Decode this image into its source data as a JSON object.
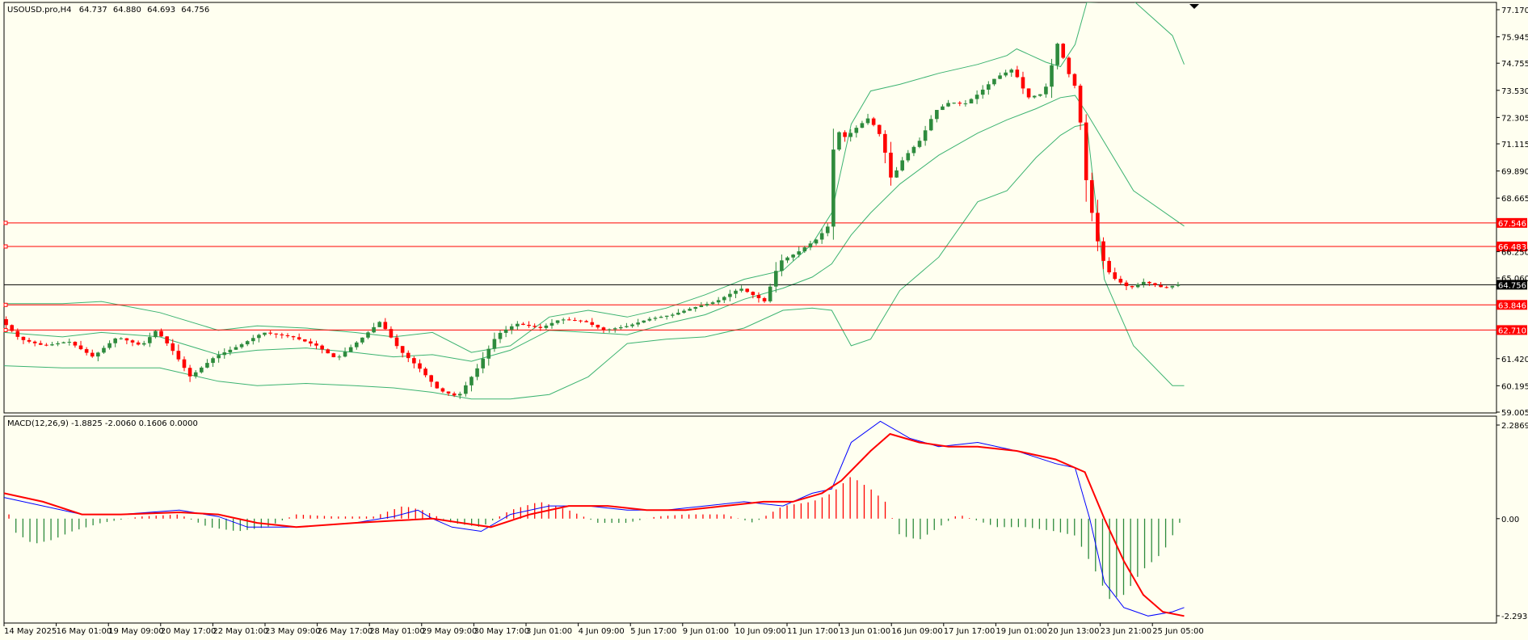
{
  "window_title": "USOUSD.pro,H4",
  "ohlc": {
    "open": "64.737",
    "high": "64.880",
    "low": "64.693",
    "close": "64.756"
  },
  "colors": {
    "background": "#fffff0",
    "bull": "#2e8b3d",
    "bear": "#ff0000",
    "bands": "#3cb371",
    "level_lines": "#ff0000",
    "price_line": "#000000",
    "macd_line": "#0000ff",
    "signal_line": "#ff0000",
    "hist_pos": "#ff0000",
    "hist_neg": "#2e8b3d"
  },
  "price_axis": {
    "ticks": [
      "77.170",
      "75.945",
      "74.755",
      "73.530",
      "72.305",
      "71.115",
      "69.890",
      "68.665",
      "66.250",
      "65.060",
      "61.420",
      "60.195",
      "59.005"
    ],
    "range": [
      59.005,
      77.17
    ]
  },
  "levels": [
    {
      "value": 67.546,
      "label": "67.546"
    },
    {
      "value": 66.483,
      "label": "66.483"
    },
    {
      "value": 63.846,
      "label": "63.846"
    },
    {
      "value": 62.71,
      "label": "62.710"
    }
  ],
  "current_price": {
    "value": 64.756,
    "label": "64.756"
  },
  "macd": {
    "title": "MACD(12,26,9) -1.8825 -2.0060 0.1606 0.0000",
    "axis_ticks": [
      "2.2869",
      "0.00",
      "-2.2938"
    ],
    "range": [
      -2.2938,
      2.2869
    ]
  },
  "time_axis": {
    "labels": [
      "14 May 2025",
      "16 May 01:00",
      "19 May 09:00",
      "20 May 17:00",
      "22 May 01:00",
      "23 May 09:00",
      "26 May 17:00",
      "28 May 01:00",
      "29 May 09:00",
      "30 May 17:00",
      "3 Jun 01:00",
      "4 Jun 09:00",
      "5 Jun 17:00",
      "9 Jun 01:00",
      "10 Jun 09:00",
      "11 Jun 17:00",
      "13 Jun 01:00",
      "16 Jun 09:00",
      "17 Jun 17:00",
      "19 Jun 01:00",
      "20 Jun 13:00",
      "23 Jun 21:00",
      "25 Jun 05:00"
    ]
  },
  "chart_data": {
    "type": "candlestick",
    "title": "USOUSD.pro,H4",
    "price_range": [
      59.005,
      77.17
    ],
    "segments": [
      [
        0,
        63.2
      ],
      [
        20,
        62.3
      ],
      [
        45,
        62.0
      ],
      [
        70,
        62.2
      ],
      [
        95,
        61.5
      ],
      [
        120,
        62.4
      ],
      [
        145,
        62.0
      ],
      [
        160,
        62.7
      ],
      [
        175,
        61.9
      ],
      [
        195,
        60.6
      ],
      [
        220,
        61.5
      ],
      [
        245,
        62.0
      ],
      [
        270,
        62.6
      ],
      [
        300,
        62.4
      ],
      [
        325,
        62.0
      ],
      [
        345,
        61.4
      ],
      [
        370,
        62.3
      ],
      [
        390,
        63.1
      ],
      [
        410,
        61.8
      ],
      [
        430,
        61.0
      ],
      [
        450,
        60.0
      ],
      [
        470,
        59.7
      ],
      [
        490,
        61.0
      ],
      [
        510,
        62.5
      ],
      [
        530,
        63.0
      ],
      [
        555,
        62.8
      ],
      [
        575,
        63.2
      ],
      [
        600,
        63.1
      ],
      [
        620,
        62.7
      ],
      [
        645,
        62.9
      ],
      [
        665,
        63.2
      ],
      [
        690,
        63.4
      ],
      [
        710,
        63.7
      ],
      [
        735,
        64.0
      ],
      [
        760,
        64.6
      ],
      [
        785,
        64.0
      ],
      [
        800,
        65.8
      ],
      [
        818,
        66.2
      ],
      [
        838,
        66.8
      ],
      [
        850,
        67.4
      ],
      [
        857,
        71.8
      ],
      [
        868,
        71.4
      ],
      [
        878,
        71.8
      ],
      [
        892,
        72.3
      ],
      [
        905,
        71.4
      ],
      [
        915,
        69.5
      ],
      [
        928,
        70.5
      ],
      [
        945,
        71.3
      ],
      [
        960,
        72.6
      ],
      [
        975,
        73.0
      ],
      [
        990,
        72.9
      ],
      [
        1005,
        73.4
      ],
      [
        1022,
        74.1
      ],
      [
        1040,
        74.5
      ],
      [
        1055,
        73.2
      ],
      [
        1072,
        73.4
      ],
      [
        1086,
        75.7
      ],
      [
        1097,
        74.3
      ],
      [
        1106,
        73.5
      ],
      [
        1115,
        69.5
      ],
      [
        1125,
        67.0
      ],
      [
        1135,
        65.5
      ],
      [
        1145,
        65.0
      ],
      [
        1160,
        64.6
      ],
      [
        1175,
        64.9
      ],
      [
        1195,
        64.6
      ],
      [
        1208,
        64.76
      ]
    ],
    "bollinger": {
      "upper": [
        [
          0,
          63.9
        ],
        [
          60,
          63.9
        ],
        [
          100,
          64.0
        ],
        [
          160,
          63.5
        ],
        [
          220,
          62.7
        ],
        [
          260,
          62.9
        ],
        [
          310,
          62.8
        ],
        [
          360,
          62.6
        ],
        [
          400,
          62.4
        ],
        [
          440,
          62.6
        ],
        [
          480,
          61.7
        ],
        [
          520,
          62.0
        ],
        [
          560,
          63.3
        ],
        [
          600,
          63.6
        ],
        [
          640,
          63.3
        ],
        [
          680,
          63.7
        ],
        [
          720,
          64.3
        ],
        [
          760,
          65.0
        ],
        [
          800,
          65.4
        ],
        [
          830,
          66.6
        ],
        [
          850,
          68.0
        ],
        [
          870,
          72.0
        ],
        [
          890,
          73.5
        ],
        [
          920,
          73.8
        ],
        [
          960,
          74.3
        ],
        [
          1000,
          74.7
        ],
        [
          1030,
          75.1
        ],
        [
          1040,
          75.4
        ],
        [
          1070,
          74.8
        ],
        [
          1085,
          74.6
        ],
        [
          1100,
          75.6
        ],
        [
          1112,
          77.5
        ],
        [
          1160,
          80.0
        ],
        [
          1200,
          76.0
        ],
        [
          1212,
          74.7
        ]
      ],
      "middle": [
        [
          0,
          62.6
        ],
        [
          60,
          62.4
        ],
        [
          100,
          62.6
        ],
        [
          160,
          62.4
        ],
        [
          220,
          61.6
        ],
        [
          260,
          61.8
        ],
        [
          310,
          61.9
        ],
        [
          360,
          61.7
        ],
        [
          400,
          61.5
        ],
        [
          440,
          61.6
        ],
        [
          480,
          61.3
        ],
        [
          520,
          61.8
        ],
        [
          560,
          62.7
        ],
        [
          600,
          62.6
        ],
        [
          640,
          62.5
        ],
        [
          680,
          63.0
        ],
        [
          720,
          63.4
        ],
        [
          760,
          64.1
        ],
        [
          800,
          64.6
        ],
        [
          830,
          65.1
        ],
        [
          850,
          65.7
        ],
        [
          870,
          67.0
        ],
        [
          890,
          68.0
        ],
        [
          920,
          69.3
        ],
        [
          960,
          70.6
        ],
        [
          1000,
          71.6
        ],
        [
          1030,
          72.2
        ],
        [
          1060,
          72.7
        ],
        [
          1085,
          73.2
        ],
        [
          1100,
          73.3
        ],
        [
          1112,
          72.5
        ],
        [
          1160,
          69.0
        ],
        [
          1212,
          67.4
        ]
      ],
      "lower": [
        [
          0,
          61.1
        ],
        [
          60,
          61.0
        ],
        [
          100,
          61.0
        ],
        [
          160,
          61.0
        ],
        [
          220,
          60.4
        ],
        [
          260,
          60.2
        ],
        [
          310,
          60.3
        ],
        [
          360,
          60.2
        ],
        [
          400,
          60.1
        ],
        [
          440,
          59.9
        ],
        [
          480,
          59.6
        ],
        [
          520,
          59.6
        ],
        [
          560,
          59.8
        ],
        [
          600,
          60.6
        ],
        [
          640,
          62.1
        ],
        [
          680,
          62.3
        ],
        [
          720,
          62.4
        ],
        [
          760,
          62.8
        ],
        [
          800,
          63.6
        ],
        [
          830,
          63.7
        ],
        [
          850,
          63.6
        ],
        [
          870,
          62.0
        ],
        [
          890,
          62.3
        ],
        [
          920,
          64.5
        ],
        [
          960,
          66.0
        ],
        [
          1000,
          68.5
        ],
        [
          1030,
          69.0
        ],
        [
          1060,
          70.5
        ],
        [
          1085,
          71.5
        ],
        [
          1100,
          71.9
        ],
        [
          1112,
          72.0
        ],
        [
          1130,
          65.0
        ],
        [
          1160,
          62.0
        ],
        [
          1200,
          60.2
        ],
        [
          1212,
          60.2
        ]
      ]
    },
    "macd": {
      "macd_line": [
        [
          0,
          0.5
        ],
        [
          40,
          0.3
        ],
        [
          80,
          0.1
        ],
        [
          120,
          0.1
        ],
        [
          180,
          0.2
        ],
        [
          220,
          0.05
        ],
        [
          250,
          -0.2
        ],
        [
          300,
          -0.2
        ],
        [
          360,
          -0.1
        ],
        [
          400,
          0.05
        ],
        [
          425,
          0.2
        ],
        [
          440,
          0.0
        ],
        [
          460,
          -0.2
        ],
        [
          490,
          -0.3
        ],
        [
          520,
          0.1
        ],
        [
          560,
          0.3
        ],
        [
          600,
          0.3
        ],
        [
          640,
          0.2
        ],
        [
          680,
          0.2
        ],
        [
          720,
          0.3
        ],
        [
          760,
          0.4
        ],
        [
          800,
          0.3
        ],
        [
          830,
          0.6
        ],
        [
          850,
          0.7
        ],
        [
          870,
          1.8
        ],
        [
          900,
          2.3
        ],
        [
          930,
          1.9
        ],
        [
          960,
          1.7
        ],
        [
          1000,
          1.8
        ],
        [
          1040,
          1.6
        ],
        [
          1080,
          1.3
        ],
        [
          1100,
          1.2
        ],
        [
          1115,
          0.0
        ],
        [
          1130,
          -1.5
        ],
        [
          1150,
          -2.1
        ],
        [
          1175,
          -2.3
        ],
        [
          1200,
          -2.2
        ],
        [
          1212,
          -2.1
        ]
      ],
      "signal_line": [
        [
          0,
          0.6
        ],
        [
          40,
          0.4
        ],
        [
          80,
          0.1
        ],
        [
          120,
          0.1
        ],
        [
          180,
          0.15
        ],
        [
          220,
          0.1
        ],
        [
          260,
          -0.1
        ],
        [
          300,
          -0.2
        ],
        [
          360,
          -0.1
        ],
        [
          400,
          -0.05
        ],
        [
          440,
          0.0
        ],
        [
          470,
          -0.1
        ],
        [
          500,
          -0.2
        ],
        [
          540,
          0.1
        ],
        [
          580,
          0.3
        ],
        [
          620,
          0.3
        ],
        [
          660,
          0.2
        ],
        [
          700,
          0.2
        ],
        [
          740,
          0.3
        ],
        [
          780,
          0.4
        ],
        [
          810,
          0.4
        ],
        [
          840,
          0.6
        ],
        [
          860,
          0.9
        ],
        [
          890,
          1.6
        ],
        [
          910,
          2.0
        ],
        [
          940,
          1.8
        ],
        [
          970,
          1.7
        ],
        [
          1000,
          1.7
        ],
        [
          1040,
          1.6
        ],
        [
          1080,
          1.4
        ],
        [
          1110,
          1.1
        ],
        [
          1130,
          0.0
        ],
        [
          1150,
          -1.0
        ],
        [
          1170,
          -1.8
        ],
        [
          1190,
          -2.2
        ],
        [
          1212,
          -2.3
        ]
      ],
      "histogram_sample": [
        [
          10,
          -0.3
        ],
        [
          30,
          -0.6
        ],
        [
          50,
          -0.5
        ],
        [
          70,
          -0.3
        ],
        [
          100,
          -0.1
        ],
        [
          140,
          0.05
        ],
        [
          180,
          0.1
        ],
        [
          210,
          -0.2
        ],
        [
          240,
          -0.3
        ],
        [
          270,
          -0.2
        ],
        [
          300,
          0.1
        ],
        [
          340,
          0.05
        ],
        [
          380,
          0.05
        ],
        [
          410,
          0.3
        ],
        [
          430,
          0.2
        ],
        [
          460,
          -0.1
        ],
        [
          490,
          -0.2
        ],
        [
          520,
          0.2
        ],
        [
          550,
          0.4
        ],
        [
          580,
          0.2
        ],
        [
          610,
          -0.1
        ],
        [
          640,
          -0.1
        ],
        [
          670,
          0.05
        ],
        [
          700,
          0.1
        ],
        [
          740,
          0.1
        ],
        [
          770,
          -0.1
        ],
        [
          800,
          0.3
        ],
        [
          830,
          0.4
        ],
        [
          850,
          0.6
        ],
        [
          870,
          1.0
        ],
        [
          890,
          0.7
        ],
        [
          905,
          0.4
        ],
        [
          920,
          -0.4
        ],
        [
          940,
          -0.5
        ],
        [
          960,
          -0.2
        ],
        [
          980,
          0.1
        ],
        [
          1000,
          -0.05
        ],
        [
          1020,
          -0.2
        ],
        [
          1050,
          -0.2
        ],
        [
          1080,
          -0.3
        ],
        [
          1100,
          -0.4
        ],
        [
          1120,
          -1.2
        ],
        [
          1135,
          -1.9
        ],
        [
          1150,
          -1.8
        ],
        [
          1170,
          -1.2
        ],
        [
          1190,
          -0.8
        ],
        [
          1205,
          -0.2
        ],
        [
          1212,
          0.1
        ]
      ]
    }
  }
}
